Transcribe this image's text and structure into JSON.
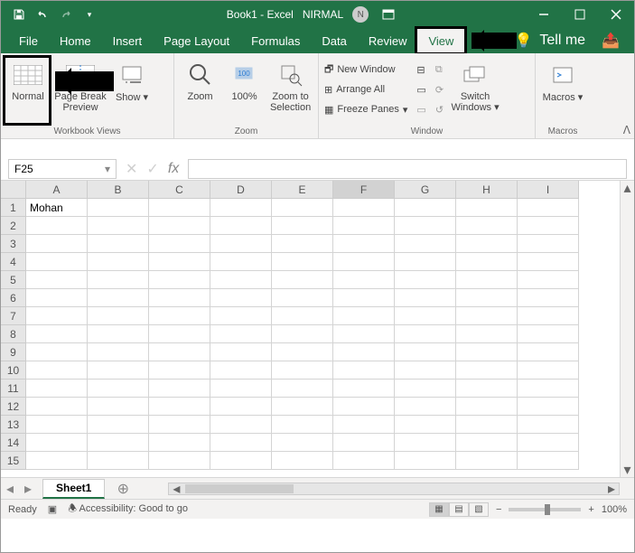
{
  "title": "Book1 - Excel",
  "user": "NIRMAL",
  "user_initial": "N",
  "tabs": {
    "file": "File",
    "home": "Home",
    "insert": "Insert",
    "page_layout": "Page Layout",
    "formulas": "Formulas",
    "data": "Data",
    "review": "Review",
    "view": "View"
  },
  "tellme": "Tell me",
  "ribbon": {
    "workbook_views": {
      "label": "Workbook Views",
      "normal": "Normal",
      "page_break": "Page Break Preview",
      "show": "Show"
    },
    "zoom": {
      "label": "Zoom",
      "zoom": "Zoom",
      "hundred": "100%",
      "selection": "Zoom to Selection"
    },
    "window": {
      "label": "Window",
      "new_window": "New Window",
      "arrange_all": "Arrange All",
      "freeze": "Freeze Panes",
      "switch": "Switch Windows"
    },
    "macros": {
      "label": "Macros",
      "macros": "Macros"
    }
  },
  "namebox": "F25",
  "columns": [
    "A",
    "B",
    "C",
    "D",
    "E",
    "F",
    "G",
    "H",
    "I"
  ],
  "rows": [
    1,
    2,
    3,
    4,
    5,
    6,
    7,
    8,
    9,
    10,
    11,
    12,
    13,
    14,
    15
  ],
  "cell_data": {
    "A1": "Mohan"
  },
  "active_col": "F",
  "sheet": "Sheet1",
  "status": {
    "ready": "Ready",
    "accessibility": "Accessibility: Good to go",
    "zoom": "100%"
  }
}
